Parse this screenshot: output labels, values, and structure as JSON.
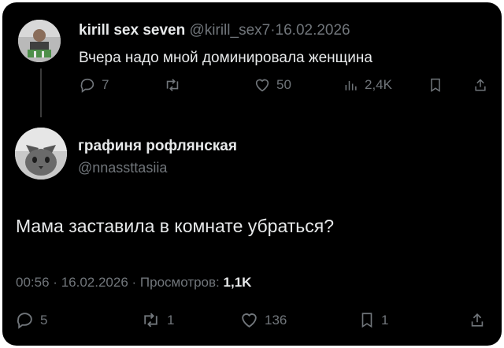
{
  "reply_tweet": {
    "display_name": "kirill sex seven",
    "handle": "@kirill_sex7",
    "separator": "·",
    "date": "16.02.2026",
    "text": "Вчера надо мной доминировала женщина",
    "actions": {
      "replies": "7",
      "reposts": "",
      "likes": "50",
      "views": "2,4K",
      "bookmarks": "",
      "share": ""
    }
  },
  "main_tweet": {
    "display_name": "графиня рофлянская",
    "handle": "@nnassttasiia",
    "text": "Мама заставила в комнате убраться?",
    "time": "00:56",
    "separator": "·",
    "date": "16.02.2026",
    "views_label": "Просмотров:",
    "views_count": "1,1K",
    "actions": {
      "replies": "5",
      "reposts": "1",
      "likes": "136",
      "bookmarks": "1",
      "share": ""
    }
  },
  "colors": {
    "background": "#000000",
    "text_primary": "#e7e9ea",
    "text_muted": "#71767b"
  },
  "icons": [
    "reply-icon",
    "repost-icon",
    "like-icon",
    "views-icon",
    "bookmark-icon",
    "share-icon"
  ]
}
